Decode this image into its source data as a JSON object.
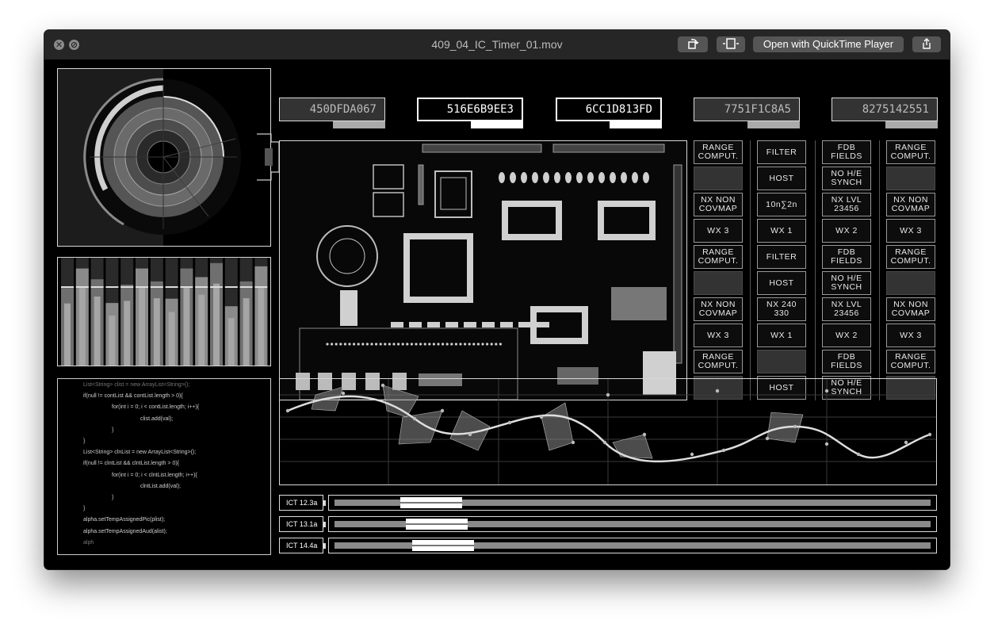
{
  "window": {
    "title": "409_04_IC_Timer_01.mov",
    "open_with_label": "Open with QuickTime Player",
    "close_glyph": "✕",
    "minimize_glyph": "⊘"
  },
  "hex_codes": [
    {
      "code": "450DFDA067",
      "active": false
    },
    {
      "code": "516E6B9EE3",
      "active": true
    },
    {
      "code": "6CC1D813FD",
      "active": true
    },
    {
      "code": "7751F1C8A5",
      "active": false
    },
    {
      "code": "8275142551",
      "active": false
    }
  ],
  "button_grid": {
    "columns": [
      [
        "RANGE\nCOMPUT.",
        "",
        "NX NON\nCOVMAP",
        "WX 3",
        "RANGE\nCOMPUT.",
        "",
        "NX NON\nCOVMAP",
        "WX 3",
        "RANGE\nCOMPUT.",
        ""
      ],
      [
        "FILTER",
        "HOST",
        "10n∑2n",
        "WX 1",
        "FILTER",
        "HOST",
        "NX 240\n330",
        "WX 1",
        "",
        "HOST"
      ],
      [
        "FDB\nFIELDS",
        "NO H/E\nSYNCH",
        "NX LVL\n23456",
        "WX 2",
        "FDB\nFIELDS",
        "NO H/E\nSYNCH",
        "NX LVL\n23456",
        "WX 2",
        "FDB\nFIELDS",
        "NO H/E\nSYNCH"
      ],
      [
        "RANGE\nCOMPUT.",
        "",
        "NX NON\nCOVMAP",
        "WX 3",
        "RANGE\nCOMPUT.",
        "",
        "NX NON\nCOVMAP",
        "WX 3",
        "RANGE\nCOMPUT.",
        ""
      ]
    ]
  },
  "code_lines": [
    "List<String> clist = new ArrayList<String>();",
    "if(null != contList && contList.length > 0){",
    "for(int i = 0; i < contList.length; i++){",
    "clist.add(val);",
    "}",
    "}",
    "List<String> clnList = new ArrayList<String>();",
    "if(null != clntList && clntList.length > 0){",
    "for(int i = 0; i < clntList.length; i++){",
    "clntList.add(val);",
    "}",
    "}",
    "alpha.setTempAssignedPic(plist);",
    "alpha.setTempAssignedAud(alist);",
    "alph"
  ],
  "timelines": [
    {
      "label": "ICT 12.3a",
      "position": 0.11
    },
    {
      "label": "ICT 13.1a",
      "position": 0.12
    },
    {
      "label": "ICT 14.4a",
      "position": 0.13
    }
  ],
  "level_bars": [
    0.72,
    0.9,
    0.8,
    0.58,
    0.75,
    0.9,
    0.78,
    0.62,
    0.9,
    0.82,
    0.95,
    0.55,
    0.78,
    0.92
  ],
  "colors": {
    "panel_border": "#d8d8d8",
    "accent": "#ffffff",
    "titlebar": "#262626"
  }
}
